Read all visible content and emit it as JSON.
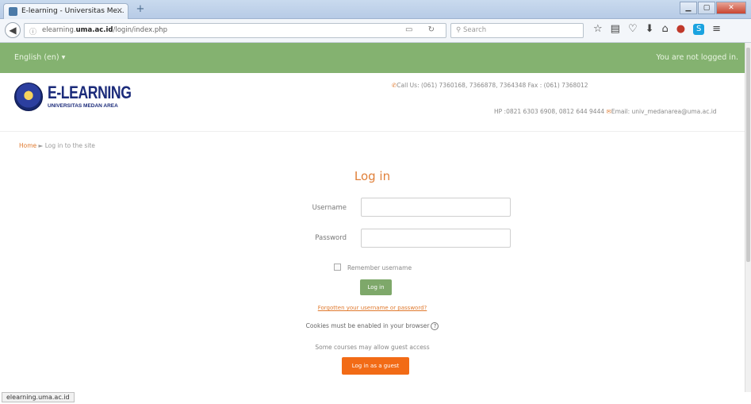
{
  "browser": {
    "tab_title": "E-learning - Universitas Me...",
    "tab_close": "×",
    "new_tab": "+",
    "url_prefix": "elearning.",
    "url_domain": "uma.ac.id",
    "url_path": "/login/index.php",
    "search_placeholder": "Search",
    "status_url": "elearning.uma.ac.id"
  },
  "site": {
    "language": "English (en) ▾",
    "login_status": "You are not logged in.",
    "logo_title": "E-LEARNING",
    "logo_subtitle": "UNIVERSITAS MEDAN AREA",
    "contact_line1": "Call Us: (061) 7360168, 7366878, 7364348 Fax : (061) 7368012",
    "contact_line2_hp": "HP :0821 6303 6908, 0812 644 9444",
    "contact_line2_email": "Email: univ_medanarea@uma.ac.id"
  },
  "breadcrumb": {
    "home": "Home",
    "separator": "►",
    "current": "Log in to the site"
  },
  "login": {
    "title": "Log in",
    "username_label": "Username",
    "username_value": "",
    "password_label": "Password",
    "password_value": "",
    "remember_label": "Remember username",
    "remember_checked": false,
    "login_button": "Log in",
    "forgot_link": "Forgotten your username or password?",
    "cookies_note": "Cookies must be enabled in your browser",
    "guest_note": "Some courses may allow guest access",
    "guest_button": "Log in as a guest"
  },
  "colors": {
    "green_bar": "#84b270",
    "accent_orange": "#e07a2f",
    "guest_button": "#f26b16",
    "login_button": "#7ea86a",
    "logo_blue": "#1b2b7a"
  }
}
